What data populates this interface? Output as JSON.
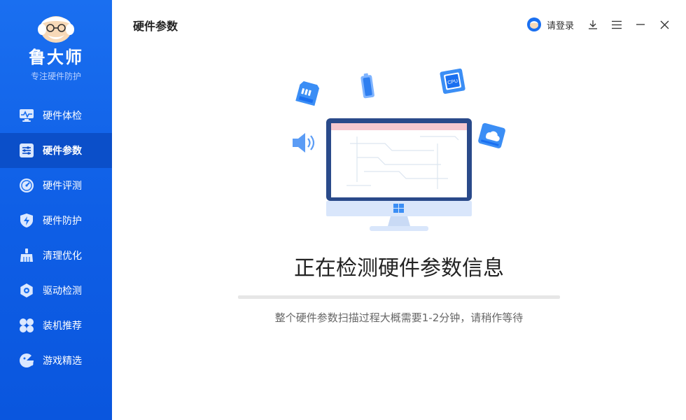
{
  "brand": {
    "name": "鲁大师",
    "slogan": "专注硬件防护"
  },
  "nav": {
    "items": [
      {
        "label": "硬件体检",
        "icon": "monitor-pulse-icon",
        "active": false
      },
      {
        "label": "硬件参数",
        "icon": "sliders-icon",
        "active": true
      },
      {
        "label": "硬件评测",
        "icon": "speedometer-icon",
        "active": false
      },
      {
        "label": "硬件防护",
        "icon": "shield-bolt-icon",
        "active": false
      },
      {
        "label": "清理优化",
        "icon": "broom-icon",
        "active": false
      },
      {
        "label": "驱动检测",
        "icon": "gear-icon",
        "active": false
      },
      {
        "label": "装机推荐",
        "icon": "puzzle-icon",
        "active": false
      },
      {
        "label": "游戏精选",
        "icon": "gamepad-icon",
        "active": false
      }
    ]
  },
  "header": {
    "title": "硬件参数",
    "login_label": "请登录"
  },
  "main": {
    "headline": "正在检测硬件参数信息",
    "progress": 0,
    "subtitle": "整个硬件参数扫描过程大概需要1-2分钟，请稍作等待",
    "cpu_chip_label": "CPU"
  },
  "colors": {
    "sidebar": "#1a6ff0",
    "active_nav": "#0b4fc9",
    "accent": "#1a6ff0"
  }
}
